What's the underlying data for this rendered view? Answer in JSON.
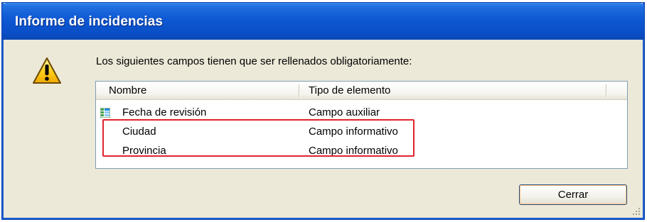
{
  "window": {
    "title": "Informe de incidencias"
  },
  "message": "Los siguientes campos tienen que ser rellenados obligatoriamente:",
  "table": {
    "columns": [
      "Nombre",
      "Tipo de elemento"
    ],
    "rows": [
      {
        "name": "Fecha de revisión",
        "type": "Campo auxiliar",
        "icon": "grid-field-icon"
      },
      {
        "name": "Ciudad",
        "type": "Campo informativo"
      },
      {
        "name": "Provincia",
        "type": "Campo informativo"
      }
    ]
  },
  "buttons": {
    "close_label": "Cerrar"
  },
  "colors": {
    "titlebar": "#0a4fc7",
    "highlight": "#e0242e",
    "dialog_background": "#ece9d8"
  }
}
